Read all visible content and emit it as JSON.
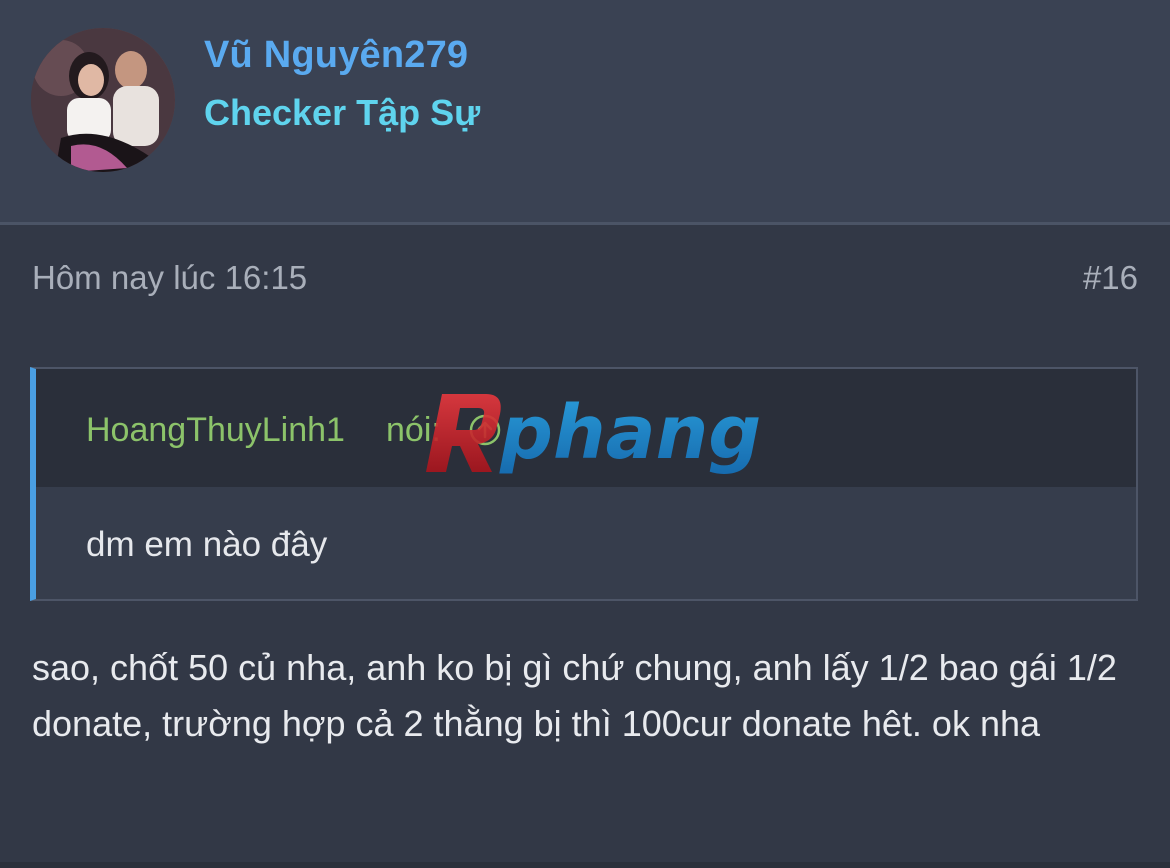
{
  "user": {
    "name": "Vũ Nguyên279",
    "title": "Checker Tập Sự",
    "avatar_icon": "user-avatar"
  },
  "post": {
    "time": "Hôm nay lúc 16:15",
    "number": "#16",
    "quote": {
      "author": "HoangThuyLinh1",
      "says": "nói:",
      "jump_icon": "arrow-up-circle-icon",
      "text": "dm em nào đây"
    },
    "message": "sao, chốt 50 củ nha, anh ko bị gì chứ chung, anh lấy 1/2 bao gái 1/2 donate, trường hợp cả 2 thằng bị thì 100cur donate hêt. ok nha"
  },
  "watermark": {
    "text": "Rphang",
    "colors": {
      "first_letter": "#d8262c",
      "rest": "#1f8fd6"
    }
  },
  "colors": {
    "background": "#323846",
    "header": "#3a4253",
    "username": "#5aaaf0",
    "user_title": "#5fd4ee",
    "quote_author": "#8cc36a",
    "quote_border": "#4a9fe3"
  }
}
